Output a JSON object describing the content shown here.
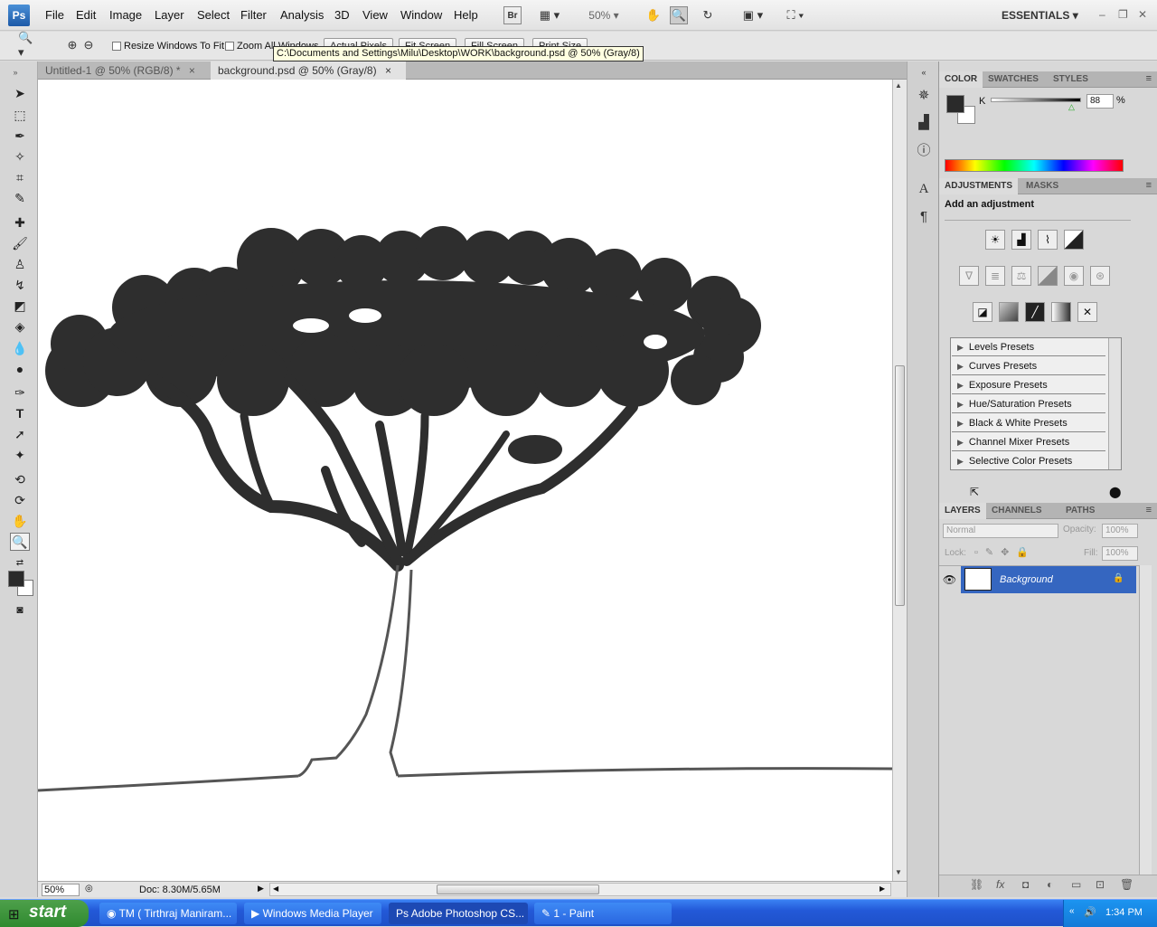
{
  "menubar": {
    "logo": "Ps",
    "items": [
      "File",
      "Edit",
      "Image",
      "Layer",
      "Select",
      "Filter",
      "Analysis",
      "3D",
      "View",
      "Window",
      "Help"
    ],
    "bridge": "Br",
    "zoom": "50%",
    "workspace": "ESSENTIALS"
  },
  "options": {
    "resize_windows": "Resize Windows To Fit",
    "zoom_all": "Zoom All Windows",
    "actual_pixels": "Actual Pixels",
    "fit_screen": "Fit Screen",
    "fill_screen": "Fill Screen",
    "print_size": "Print Size",
    "tooltip": "C:\\Documents and Settings\\Milu\\Desktop\\WORK\\background.psd @ 50% (Gray/8)"
  },
  "tabs": [
    {
      "label": "Untitled-1 @ 50% (RGB/8) *"
    },
    {
      "label": "background.psd @ 50% (Gray/8)"
    }
  ],
  "status": {
    "zoom": "50%",
    "doc": "Doc: 8.30M/5.65M"
  },
  "color_panel": {
    "tabs": [
      "COLOR",
      "SWATCHES",
      "STYLES"
    ],
    "channel": "K",
    "value": "88",
    "unit": "%"
  },
  "adjustments_panel": {
    "tabs": [
      "ADJUSTMENTS",
      "MASKS"
    ],
    "heading": "Add an adjustment",
    "presets": [
      "Levels Presets",
      "Curves Presets",
      "Exposure Presets",
      "Hue/Saturation Presets",
      "Black & White Presets",
      "Channel Mixer Presets",
      "Selective Color Presets"
    ]
  },
  "layers_panel": {
    "tabs": [
      "LAYERS",
      "CHANNELS",
      "PATHS"
    ],
    "blend": "Normal",
    "opacity_label": "Opacity:",
    "opacity": "100%",
    "lock_label": "Lock:",
    "fill_label": "Fill:",
    "fill": "100%",
    "layer_name": "Background"
  },
  "taskbar": {
    "start": "start",
    "tasks": [
      "TM ( Tirthraj Maniram...",
      "Windows Media Player",
      "Adobe Photoshop CS...",
      "1 - Paint"
    ],
    "clock": "1:34 PM"
  }
}
